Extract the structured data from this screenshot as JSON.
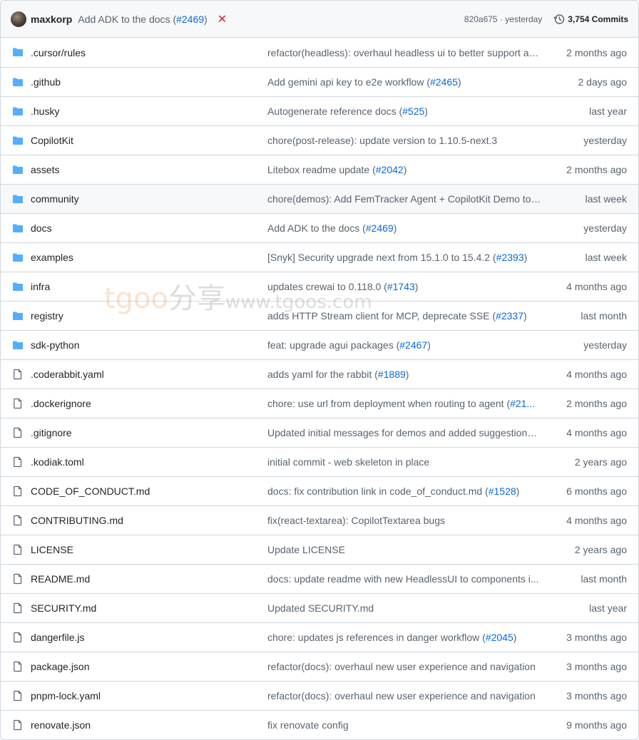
{
  "header": {
    "author": "maxkorp",
    "commit_message": "Add ADK to the docs (",
    "commit_pr": "#2469",
    "commit_message_end": ")",
    "status_icon": "x-icon",
    "hash_time": "820a675 · yesterday",
    "commits_label": "3,754 Commits"
  },
  "watermark": {
    "brand": "tgoo",
    "cn": "分享",
    "url": "www.tgoos.com"
  },
  "rows": [
    {
      "type": "folder",
      "name": ".cursor/rules",
      "msg": "refactor(headless): overhaul headless ui to better support ag...",
      "pr": "",
      "age": "2 months ago"
    },
    {
      "type": "folder",
      "name": ".github",
      "msg": "Add gemini api key to e2e workflow (",
      "pr": "#2465",
      "age": "2 days ago"
    },
    {
      "type": "folder",
      "name": ".husky",
      "msg": "Autogenerate reference docs (",
      "pr": "#525",
      "age": "last year"
    },
    {
      "type": "folder",
      "name": "CopilotKit",
      "msg": "chore(post-release): update version to 1.10.5-next.3",
      "pr": "",
      "age": "yesterday"
    },
    {
      "type": "folder",
      "name": "assets",
      "msg": "Litebox readme update (",
      "pr": "#2042",
      "age": "2 months ago"
    },
    {
      "type": "folder",
      "name": "community",
      "msg": "chore(demos): Add FemTracker Agent + CopilotKit Demo to ...",
      "pr": "",
      "age": "last week"
    },
    {
      "type": "folder",
      "name": "docs",
      "msg": "Add ADK to the docs (",
      "pr": "#2469",
      "age": "yesterday"
    },
    {
      "type": "folder",
      "name": "examples",
      "msg": "[Snyk] Security upgrade next from 15.1.0 to 15.4.2 (",
      "pr": "#2393",
      "age": "last week"
    },
    {
      "type": "folder",
      "name": "infra",
      "msg": "updates crewai to 0.118.0 (",
      "pr": "#1743",
      "age": "4 months ago"
    },
    {
      "type": "folder",
      "name": "registry",
      "msg": "adds HTTP Stream client for MCP, deprecate SSE (",
      "pr": "#2337",
      "age": "last month"
    },
    {
      "type": "folder",
      "name": "sdk-python",
      "msg": "feat: upgrade agui packages (",
      "pr": "#2467",
      "age": "yesterday"
    },
    {
      "type": "file",
      "name": ".coderabbit.yaml",
      "msg": "adds yaml for the rabbit (",
      "pr": "#1889",
      "age": "4 months ago"
    },
    {
      "type": "file",
      "name": ".dockerignore",
      "msg": "chore: use url from deployment when routing to agent (",
      "pr": "#21...",
      "age": "2 months ago"
    },
    {
      "type": "file",
      "name": ".gitignore",
      "msg": "Updated initial messages for demos and added suggestions ...",
      "pr": "",
      "age": "4 months ago"
    },
    {
      "type": "file",
      "name": ".kodiak.toml",
      "msg": "initial commit - web skeleton in place",
      "pr": "",
      "age": "2 years ago"
    },
    {
      "type": "file",
      "name": "CODE_OF_CONDUCT.md",
      "msg": "docs: fix contribution link in code_of_conduct.md (",
      "pr": "#1528",
      "age": "6 months ago"
    },
    {
      "type": "file",
      "name": "CONTRIBUTING.md",
      "msg": "fix(react-textarea): CopilotTextarea bugs",
      "pr": "",
      "age": "4 months ago"
    },
    {
      "type": "file",
      "name": "LICENSE",
      "msg": "Update LICENSE",
      "pr": "",
      "age": "2 years ago"
    },
    {
      "type": "file",
      "name": "README.md",
      "msg": "docs: update readme with new HeadlessUI to components i...",
      "pr": "",
      "age": "last month"
    },
    {
      "type": "file",
      "name": "SECURITY.md",
      "msg": "Updated SECURITY.md",
      "pr": "",
      "age": "last year"
    },
    {
      "type": "file",
      "name": "dangerfile.js",
      "msg": "chore: updates js references in danger workflow (",
      "pr": "#2045",
      "age": "3 months ago"
    },
    {
      "type": "file",
      "name": "package.json",
      "msg": "refactor(docs): overhaul new user experience and navigation",
      "pr": "",
      "age": "3 months ago"
    },
    {
      "type": "file",
      "name": "pnpm-lock.yaml",
      "msg": "refactor(docs): overhaul new user experience and navigation",
      "pr": "",
      "age": "3 months ago"
    },
    {
      "type": "file",
      "name": "renovate.json",
      "msg": "fix renovate config",
      "pr": "",
      "age": "9 months ago"
    }
  ],
  "colors": {
    "folder": "#54aeff",
    "file": "#59636e",
    "link": "#0969da"
  }
}
